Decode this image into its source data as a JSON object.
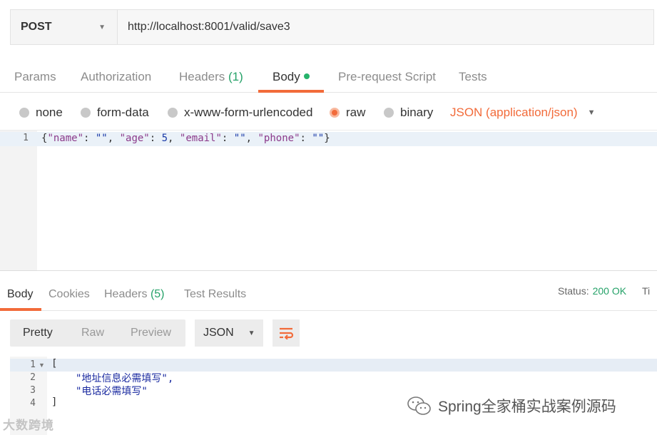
{
  "request": {
    "method": "POST",
    "url": "http://localhost:8001/valid/save3"
  },
  "request_tabs": [
    {
      "label": "Params"
    },
    {
      "label": "Authorization"
    },
    {
      "label": "Headers",
      "count": "(1)"
    },
    {
      "label": "Body"
    },
    {
      "label": "Pre-request Script"
    },
    {
      "label": "Tests"
    }
  ],
  "body_types": [
    {
      "label": "none"
    },
    {
      "label": "form-data"
    },
    {
      "label": "x-www-form-urlencoded"
    },
    {
      "label": "raw"
    },
    {
      "label": "binary"
    }
  ],
  "body_format": "JSON (application/json)",
  "editor": {
    "line_number": "1",
    "tokens": {
      "open": "{",
      "k1": "\"name\"",
      "v1": "\"\"",
      "k2": "\"age\"",
      "v2": "5",
      "k3": "\"email\"",
      "v3": "\"\"",
      "k4": "\"phone\"",
      "v4": "\"\"",
      "close": "}"
    }
  },
  "response_tabs": [
    {
      "label": "Body"
    },
    {
      "label": "Cookies"
    },
    {
      "label": "Headers",
      "count": "(5)"
    },
    {
      "label": "Test Results"
    }
  ],
  "status": {
    "label": "Status:",
    "value": "200 OK",
    "tail": "Ti"
  },
  "view_modes": [
    "Pretty",
    "Raw",
    "Preview"
  ],
  "response_format": "JSON",
  "response_lines": [
    {
      "n": "1",
      "text": "["
    },
    {
      "n": "2",
      "text": "\"地址信息必需填写\","
    },
    {
      "n": "3",
      "text": "\"电话必需填写\""
    },
    {
      "n": "4",
      "text": "]"
    }
  ],
  "watermark": {
    "left": "大数跨境",
    "right": "Spring全家桶实战案例源码"
  },
  "colors": {
    "accent": "#f26b3a",
    "success": "#26a269"
  }
}
